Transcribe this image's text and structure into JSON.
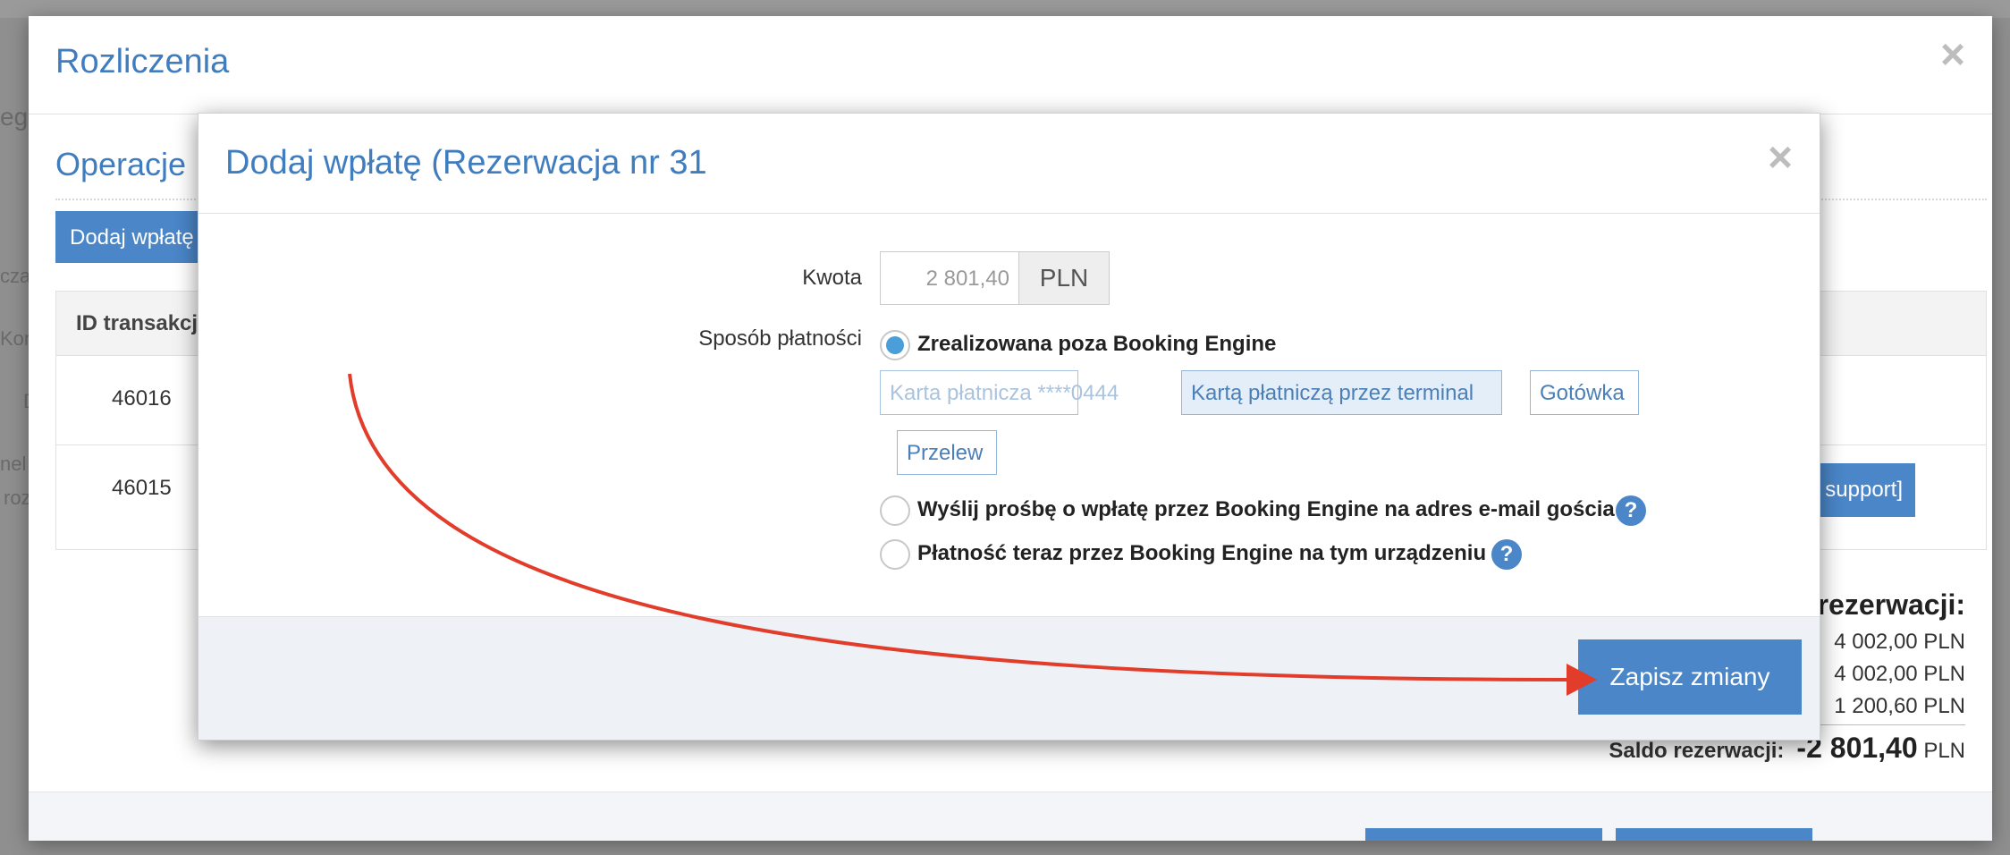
{
  "background": {
    "partial_texts": [
      "eg",
      "cza",
      "Kor",
      "D",
      "nel",
      "roz"
    ]
  },
  "outer_modal": {
    "title": "Rozliczenia",
    "close_glyph": "×",
    "operations_title": "Operacje",
    "add_payment_button": "Dodaj wpłatę",
    "table": {
      "header": "ID transakcji",
      "rows": [
        "46016",
        "46015"
      ]
    },
    "support_button": "support]",
    "summary": {
      "title": "rezerwacji:",
      "lines": [
        "4 002,00 PLN",
        "4 002,00 PLN",
        "1 200,60 PLN"
      ],
      "saldo_label": "Saldo rezerwacji:",
      "saldo_value": "-2 801,40",
      "saldo_currency": "PLN"
    }
  },
  "dialog": {
    "title": "Dodaj wpłatę (Rezerwacja nr 31",
    "close_glyph": "×",
    "amount_label": "Kwota",
    "amount_value": "2 801,40",
    "currency": "PLN",
    "payment_method_label": "Sposób płatności",
    "options": [
      {
        "label": "Zrealizowana poza Booking Engine",
        "checked": true
      },
      {
        "label": "Wyślij prośbę o wpłatę przez Booking Engine na adres e-mail gościa",
        "checked": false
      },
      {
        "label": "Płatność teraz przez Booking Engine na tym urządzeniu",
        "checked": false
      }
    ],
    "method_chips": [
      {
        "label": "Karta płatnicza ****0444",
        "state": "placeholder"
      },
      {
        "label": "Kartą płatniczą przez terminal",
        "state": "active"
      },
      {
        "label": "Gotówka",
        "state": "normal"
      },
      {
        "label": "Przelew",
        "state": "normal"
      }
    ],
    "help_glyph": "?",
    "save_button": "Zapisz zmiany"
  },
  "annotation": {
    "arrow_color": "#e23c2a"
  },
  "colors": {
    "accent": "#4a86c8",
    "title_blue": "#3f7dbf"
  }
}
